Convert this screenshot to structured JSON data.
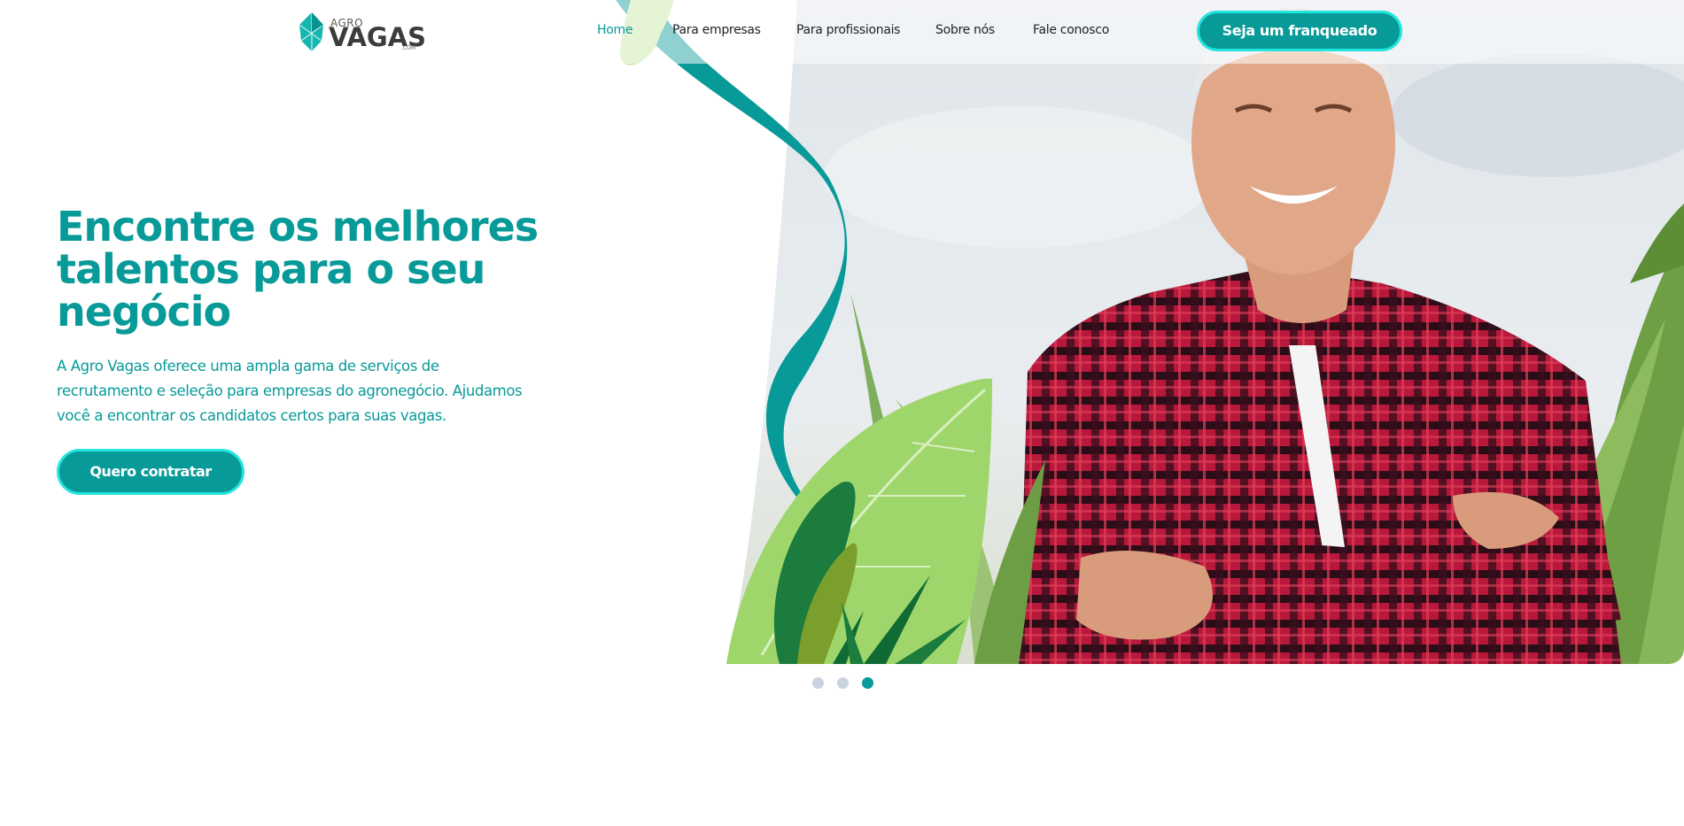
{
  "colors": {
    "brand_teal": "#079a98",
    "accent_cyan": "#22e5dd",
    "leaf_green": "#8fce5c",
    "dark_leaf": "#1a7a3a",
    "dot_inactive": "#c9d3e0"
  },
  "header": {
    "logo": {
      "top": "AGRO",
      "main": "VAGAS",
      "suffix": ".COM",
      "icon": "leaf-crystal-icon"
    },
    "nav": [
      {
        "label": "Home",
        "active": true
      },
      {
        "label": "Para empresas",
        "active": false
      },
      {
        "label": "Para profissionais",
        "active": false
      },
      {
        "label": "Sobre nós",
        "active": false
      },
      {
        "label": "Fale conosco",
        "active": false
      }
    ],
    "cta_label": "Seja um franqueado"
  },
  "hero": {
    "title": "Encontre os melhores talentos para o seu negócio",
    "text": "A Agro Vagas oferece uma ampla gama de serviços de recrutamento e seleção para empresas do agronegócio. Ajudamos você a encontrar os candidatos certos para suas vagas.",
    "cta_label": "Quero contratar",
    "image": "smiling-farmer-in-plaid-shirt-photo"
  },
  "carousel": {
    "slides": 3,
    "active_index": 2
  }
}
